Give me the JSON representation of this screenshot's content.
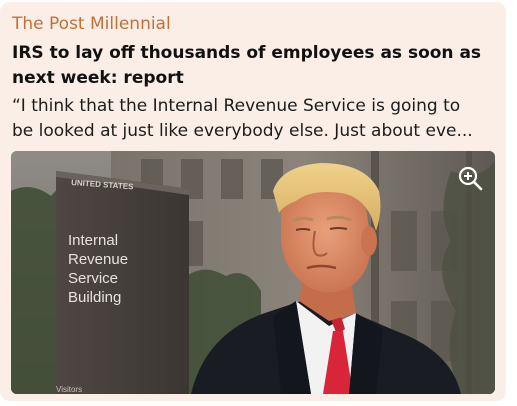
{
  "card": {
    "source": "The Post Millennial",
    "headline": "IRS to lay off thousands of employees as soon as next week: report",
    "excerpt_line1": "“I think that the Internal Revenue Service is going to",
    "excerpt_line2": "be looked at just like everybody else. Just about eve..."
  },
  "image": {
    "sign_header": "UNITED STATES",
    "sign_line1": "Internal",
    "sign_line2": "Revenue",
    "sign_line3": "Service",
    "sign_line4": "Building",
    "sign_footer": "Visitors",
    "zoom_icon": "zoom-in-icon"
  },
  "colors": {
    "card_bg": "#faeee6",
    "source": "#c2703a",
    "headline": "#111111",
    "tie": "#d8253a"
  }
}
